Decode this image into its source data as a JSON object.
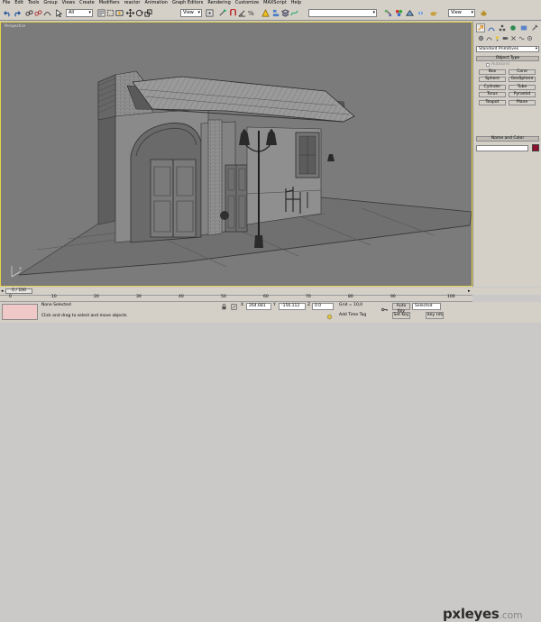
{
  "menu": [
    "File",
    "Edit",
    "Tools",
    "Group",
    "Views",
    "Create",
    "Modifiers",
    "reactor",
    "Animation",
    "Graph Editors",
    "Rendering",
    "Customize",
    "MAXScript",
    "Help"
  ],
  "toolbar": {
    "selection_filter": "All",
    "ref_coord": "View",
    "named_selection": "",
    "render_view": "View"
  },
  "viewport": {
    "label": "Perspective"
  },
  "command_panel": {
    "category": "Standard Primitives",
    "object_type_title": "Object Type",
    "autogrid": "AutoGrid",
    "objects": [
      "Box",
      "Cone",
      "Sphere",
      "GeoSphere",
      "Cylinder",
      "Tube",
      "Torus",
      "Pyramid",
      "Teapot",
      "Plane"
    ],
    "name_color_title": "Name and Color",
    "object_color": "#8c0f2d"
  },
  "timeline": {
    "slider_label": "0 / 100",
    "ticks": [
      "0",
      "10",
      "20",
      "30",
      "40",
      "50",
      "60",
      "70",
      "80",
      "90",
      "100"
    ]
  },
  "status": {
    "selection": "None Selected",
    "prompt": "Click and drag to select and move objects",
    "x": "264.681",
    "y": "-156.112",
    "z": "0.0",
    "grid": "Grid = 10,0",
    "add_time_tag": "Add Time Tag",
    "auto_key": "Auto Key",
    "set_key": "Set Key",
    "key_mode": "Selected",
    "key_filters": "Key Filters..."
  },
  "watermark": {
    "brand": "pxleyes",
    "tld": ".com"
  }
}
